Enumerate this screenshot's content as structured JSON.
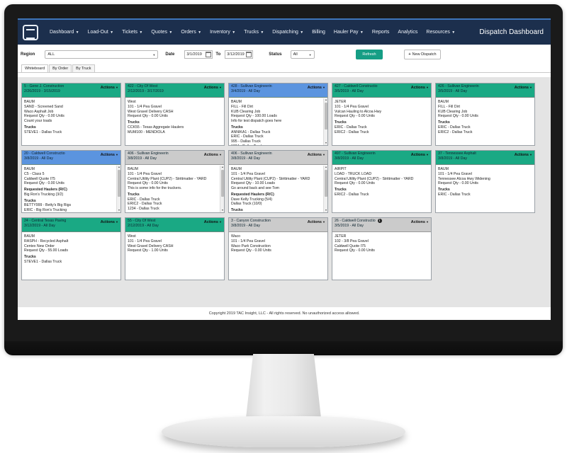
{
  "nav": {
    "items": [
      {
        "label": "Dashboard",
        "caret": true
      },
      {
        "label": "Load-Out",
        "caret": true
      },
      {
        "label": "Tickets",
        "caret": true
      },
      {
        "label": "Quotes",
        "caret": true
      },
      {
        "label": "Orders",
        "caret": true
      },
      {
        "label": "Inventory",
        "caret": true
      },
      {
        "label": "Trucks",
        "caret": true
      },
      {
        "label": "Dispatching",
        "caret": true
      },
      {
        "label": "Billing",
        "caret": false
      },
      {
        "label": "Hauler Pay",
        "caret": true
      },
      {
        "label": "Reports",
        "caret": false
      },
      {
        "label": "Analytics",
        "caret": false
      },
      {
        "label": "Resources",
        "caret": true
      }
    ],
    "title": "Dispatch Dashboard"
  },
  "filters": {
    "region_label": "Region",
    "region_value": "ALL",
    "date_label": "Date",
    "date_from": "3/1/2019",
    "to_label": "To",
    "date_to": "3/12/2019",
    "status_label": "Status",
    "status_value": "All",
    "refresh_label": "Refresh",
    "new_dispatch_label": "New Dispatch"
  },
  "tabs": [
    "Whiteboard",
    "By Order",
    "By Truck"
  ],
  "actions_label": "Actions",
  "cards": [
    {
      "color": "green",
      "title": "5 - Gene J. Construction",
      "date": "2/26/2019 - 3/15/2019",
      "lines": [
        "BAUM",
        "SAND - Screened Sand",
        "Waco Asphalt Job",
        "Request Qty - 0.00 Units",
        "Count your loads"
      ],
      "trucks_label": "Trucks",
      "trucks": [
        "STEVE1 - Dallas Truck"
      ]
    },
    {
      "color": "green",
      "title": "422 - City Of West",
      "date": "2/12/2019 - 3/17/2019",
      "lines": [
        "West",
        "101 - 1/4 Pea Gravel",
        "West Gravel Delivery CASH",
        "Request Qty - 0.00 Units"
      ],
      "trucks_label": "Trucks",
      "trucks": [
        "CCK55 - Texas Aggregate Haulers",
        "MUM100 - MENDIOLA"
      ]
    },
    {
      "color": "blue",
      "title": "428 - Sullivan Engineerin",
      "date": "3/4/2019 - All Day",
      "lines": [
        "BAUM",
        "FILL - Fill Dirt",
        "KUB Clearing Job",
        "Request Qty - 100.00 Loads",
        "Info for test dispatch goes here"
      ],
      "trucks_label": "Trucks",
      "trucks": [
        "ANNIKA1 - Dallas Truck",
        "ERIC - Dallas Truck",
        "995 - Dallas Truck",
        "1234 - Dallas Truck"
      ],
      "scroll": true
    },
    {
      "color": "green",
      "title": "427 - Caldwell Constructio",
      "date": "3/5/2019 - All Day",
      "lines": [
        "JETER",
        "101 - 1/4 Pea Gravel",
        "Vulcan Hauling to Alcoa Hwy",
        "Request Qty - 0.00 Units"
      ],
      "trucks_label": "Trucks",
      "trucks": [
        "ERIC - Dallas Truck",
        "ERIC2 - Dallas Truck"
      ]
    },
    {
      "color": "green",
      "title": "426 - Sullivan Engineerin",
      "date": "3/5/2019 - All Day",
      "lines": [
        "BAUM",
        "FILL - Fill Dirt",
        "KUB Clearing Job",
        "Request Qty - 0.00 Units"
      ],
      "trucks_label": "Trucks",
      "trucks": [
        "ERIC - Dallas Truck",
        "ERIC2 - Dallas Truck"
      ]
    },
    {
      "color": "blue",
      "title": "20 - Caldwell Constructio",
      "date": "3/8/2019 - All Day",
      "lines": [
        "BAUM",
        "C5 - Class 5",
        "Caldwell Quote I75",
        "Request Qty - 0.00 Units"
      ],
      "haulers_label": "Requested Haulers (R/C)",
      "haulers": [
        "Big Ron's Trucking (3/2)"
      ],
      "trucks_label": "Trucks",
      "trucks": [
        "BETTY999 - Betty's Big Rigs",
        "ERIC - Big Ron's Trucking",
        "406 - Big Ron's Trucking"
      ],
      "scroll": true
    },
    {
      "color": "gray",
      "title": "406 - Sullivan Engineerin",
      "date": "3/8/2019 - All Day",
      "lines": [
        "BAUM",
        "101 - 1/4 Pea Gravel",
        "Central Utility Plant (CUP2) - Strittmatter - YARD",
        "Request Qty - 0.00 Units",
        "This is some info for the truckers."
      ],
      "trucks_label": "Trucks",
      "trucks": [
        "ERIC - Dallas Truck",
        "ERIC2 - Dallas Truck",
        "1234 - Dallas Truck"
      ],
      "scroll": true
    },
    {
      "color": "gray",
      "title": "406 - Sullivan Engineerin",
      "date": "3/8/2019 - All Day",
      "lines": [
        "BAUM",
        "101 - 1/4 Pea Gravel",
        "Central Utility Plant (CUP2) - Strittmatter - YARD",
        "Request Qty - 10.00 Loads",
        "Go around back and see Tom"
      ],
      "haulers_label": "Requested Haulers (R/C)",
      "haulers": [
        "Dave Kelly Trucking (5/4)",
        "Dallas Truck (10/0)"
      ],
      "trucks_label": "Trucks",
      "trucks": [
        "ERIC - Dallas Truck"
      ],
      "scroll": true
    },
    {
      "color": "green",
      "title": "497 - Sullivan Engineerin",
      "date": "3/8/2019 - All Day",
      "lines": [
        "AIRPIT",
        "LOAD - TRUCK LOAD",
        "Central Utility Plant (CUP2) - Strittmatter - YARD",
        "Request Qty - 0.00 Units"
      ],
      "trucks_label": "Trucks",
      "trucks": [
        "ERIC2 - Dallas Truck"
      ]
    },
    {
      "color": "green",
      "title": "37 - Tennessee Asphalt",
      "date": "3/8/2019 - All Day",
      "lines": [
        "BAUM",
        "101 - 1/4 Pea Gravel",
        "Tennessee Alcoa Hwy Widening",
        "Request Qty - 0.00 Units"
      ],
      "trucks_label": "Trucks",
      "trucks": [
        "ERIC - Dallas Truck"
      ]
    },
    {
      "color": "green",
      "title": "24 - Central Texas Paving",
      "date": "3/12/2019 - All Day",
      "lines": [
        "BAUM",
        "RASPH - Recycled Asphalt",
        "Centex New Order",
        "Request Qty - 55.00 Loads"
      ],
      "trucks_label": "Trucks",
      "trucks": [
        "STEVE1 - Dallas Truck"
      ]
    },
    {
      "color": "green",
      "title": "55 - City Of West",
      "date": "2/12/2019 - All Day",
      "lines": [
        "West",
        "101 - 1/4 Pea Gravel",
        "West Gravel Delivery CASH",
        "Request Qty - 1.00 Units"
      ]
    },
    {
      "color": "gray",
      "title": "3 - Canyon Construction",
      "date": "3/8/2019 - All Day",
      "lines": [
        "Waco",
        "101 - 1/4 Pea Gravel",
        "Waco Park Construction",
        "Request Qty - 0.00 Units"
      ]
    },
    {
      "color": "gray",
      "title": "26 - Caldwell Constructio",
      "date": "3/5/2019 - All Day",
      "info_icon": true,
      "lines": [
        "JETER",
        "102 - 3/8 Pea Gravel",
        "Caldwell Quote I75",
        "Request Qty - 0.00 Units"
      ]
    }
  ],
  "footer": "Copyright 2019 TAC Insight, LLC - All rights reserved. No unauthorized access allowed."
}
